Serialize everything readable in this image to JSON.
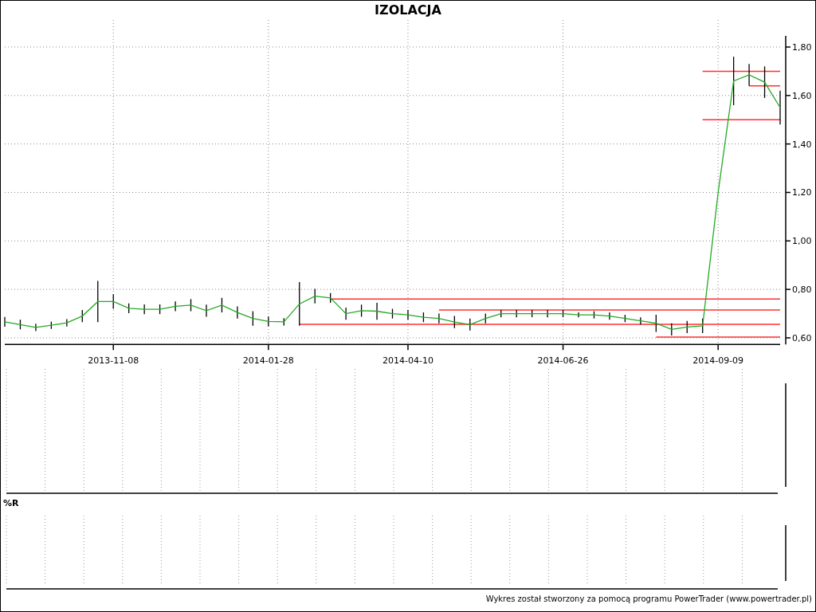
{
  "title": "IZOLACJA",
  "chart_data": {
    "type": "line",
    "grid": true,
    "categories": [
      null,
      null,
      null,
      null,
      null,
      null,
      null,
      "2013-11-08",
      null,
      null,
      null,
      null,
      null,
      null,
      null,
      null,
      null,
      "2014-01-28",
      null,
      null,
      null,
      null,
      null,
      null,
      null,
      null,
      "2014-04-10",
      null,
      null,
      null,
      null,
      null,
      null,
      null,
      null,
      null,
      "2014-06-26",
      null,
      null,
      null,
      null,
      null,
      null,
      null,
      null,
      null,
      "2014-09-09",
      null,
      null,
      null,
      null
    ],
    "series": [
      {
        "color": "#22aa22",
        "values": [
          0.666,
          0.655,
          0.643,
          0.652,
          0.662,
          0.69,
          0.75,
          0.75,
          0.722,
          0.718,
          0.718,
          0.73,
          0.735,
          0.712,
          0.735,
          0.705,
          0.68,
          0.668,
          0.666,
          0.74,
          0.772,
          0.765,
          0.7,
          0.712,
          0.71,
          0.7,
          0.695,
          0.685,
          0.68,
          0.665,
          0.655,
          0.68,
          0.7,
          0.7,
          0.7,
          0.7,
          0.7,
          0.695,
          0.695,
          0.69,
          0.68,
          0.67,
          0.66,
          0.635,
          0.645,
          0.65,
          1.2,
          1.66,
          1.685,
          1.655,
          1.55
        ],
        "errors": [
          0.02,
          0.02,
          0.015,
          0.015,
          0.015,
          0.025,
          0.085,
          0.03,
          0.02,
          0.02,
          0.02,
          0.02,
          0.025,
          0.025,
          0.03,
          0.025,
          0.03,
          0.02,
          0.015,
          0.09,
          0.03,
          0.02,
          0.025,
          0.025,
          0.035,
          0.02,
          0.02,
          0.02,
          0.02,
          0.025,
          0.025,
          0.02,
          0.015,
          0.015,
          0.015,
          0.015,
          0.015,
          0.01,
          0.015,
          0.015,
          0.015,
          0.015,
          0.035,
          0.025,
          0.025,
          0.03,
          null,
          0.1,
          0.045,
          0.065,
          0.07
        ]
      },
      {
        "color": "#ff3030",
        "values": [
          null,
          null,
          null,
          null,
          null,
          null,
          null,
          null,
          null,
          null,
          null,
          null,
          null,
          null,
          null,
          null,
          null,
          null,
          null,
          null,
          null,
          0.76,
          0.76,
          0.76,
          0.76,
          0.76,
          0.76,
          0.76,
          0.76,
          0.76,
          0.76,
          0.76,
          0.76,
          0.76,
          0.76,
          0.76,
          0.76,
          0.76,
          0.76,
          0.76,
          0.76,
          0.76,
          0.76,
          0.76,
          0.76,
          0.76,
          0.76,
          0.76,
          0.76,
          0.76,
          0.76
        ]
      },
      {
        "color": "#ff3030",
        "values": [
          null,
          null,
          null,
          null,
          null,
          null,
          null,
          null,
          null,
          null,
          null,
          null,
          null,
          null,
          null,
          null,
          null,
          null,
          null,
          null,
          null,
          null,
          null,
          null,
          null,
          null,
          null,
          null,
          0.715,
          0.715,
          0.715,
          0.715,
          0.715,
          0.715,
          0.715,
          0.715,
          0.715,
          0.715,
          0.715,
          0.715,
          0.715,
          0.715,
          0.715,
          0.715,
          0.715,
          0.715,
          0.715,
          0.715,
          0.715,
          0.715,
          0.715
        ]
      },
      {
        "color": "#ff3030",
        "values": [
          null,
          null,
          null,
          null,
          null,
          null,
          null,
          null,
          null,
          null,
          null,
          null,
          null,
          null,
          null,
          null,
          null,
          null,
          null,
          0.656,
          0.656,
          0.656,
          0.656,
          0.656,
          0.656,
          0.656,
          0.656,
          0.656,
          0.656,
          0.656,
          0.656,
          0.656,
          0.656,
          0.656,
          0.656,
          0.656,
          0.656,
          0.656,
          0.656,
          0.656,
          0.656,
          0.656,
          0.656,
          0.656,
          0.656,
          0.656,
          0.656,
          0.656,
          0.656,
          0.656,
          0.656
        ]
      },
      {
        "color": "#ff3030",
        "values": [
          null,
          null,
          null,
          null,
          null,
          null,
          null,
          null,
          null,
          null,
          null,
          null,
          null,
          null,
          null,
          null,
          null,
          null,
          null,
          null,
          null,
          null,
          null,
          null,
          null,
          null,
          null,
          null,
          null,
          null,
          null,
          null,
          null,
          null,
          null,
          null,
          null,
          null,
          null,
          null,
          null,
          null,
          0.603,
          0.603,
          0.603,
          0.603,
          0.603,
          0.603,
          0.603,
          0.603,
          0.603
        ]
      },
      {
        "color": "#ff3030",
        "values": [
          null,
          null,
          null,
          null,
          null,
          null,
          null,
          null,
          null,
          null,
          null,
          null,
          null,
          null,
          null,
          null,
          null,
          null,
          null,
          null,
          null,
          null,
          null,
          null,
          null,
          null,
          null,
          null,
          null,
          null,
          null,
          null,
          null,
          null,
          null,
          null,
          null,
          null,
          null,
          null,
          null,
          null,
          null,
          null,
          null,
          1.7,
          1.7,
          1.7,
          1.7,
          1.7,
          1.7
        ]
      },
      {
        "color": "#ff3030",
        "values": [
          null,
          null,
          null,
          null,
          null,
          null,
          null,
          null,
          null,
          null,
          null,
          null,
          null,
          null,
          null,
          null,
          null,
          null,
          null,
          null,
          null,
          null,
          null,
          null,
          null,
          null,
          null,
          null,
          null,
          null,
          null,
          null,
          null,
          null,
          null,
          null,
          null,
          null,
          null,
          null,
          null,
          null,
          null,
          null,
          null,
          null,
          null,
          null,
          1.64,
          1.64,
          1.64
        ]
      },
      {
        "color": "#ff3030",
        "values": [
          null,
          null,
          null,
          null,
          null,
          null,
          null,
          null,
          null,
          null,
          null,
          null,
          null,
          null,
          null,
          null,
          null,
          null,
          null,
          null,
          null,
          null,
          null,
          null,
          null,
          null,
          null,
          null,
          null,
          null,
          null,
          null,
          null,
          null,
          null,
          null,
          null,
          null,
          null,
          null,
          null,
          null,
          null,
          null,
          null,
          1.5,
          1.5,
          1.5,
          1.5,
          1.5,
          1.5
        ]
      }
    ],
    "ylim": [
      0.573,
      1.85
    ],
    "yticks": [
      {
        "value": 0.6,
        "label": "0,60"
      },
      {
        "value": 0.8,
        "label": "0,80"
      },
      {
        "value": 1.0,
        "label": "1,00"
      },
      {
        "value": 1.2,
        "label": "1,20"
      },
      {
        "value": 1.4,
        "label": "1,40"
      },
      {
        "value": 1.6,
        "label": "1,60"
      },
      {
        "value": 1.8,
        "label": "1,80"
      }
    ]
  },
  "indicator_panel": {
    "title": "%R"
  },
  "footer": "Wykres został stworzony za pomocą programu PowerTrader (www.powertrader.pl)"
}
